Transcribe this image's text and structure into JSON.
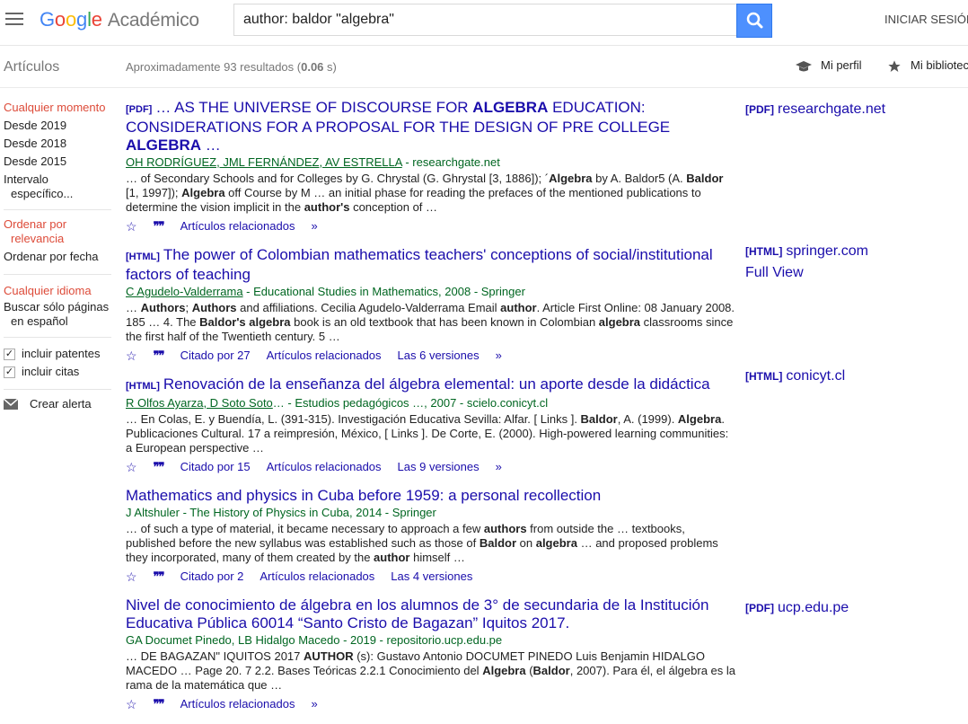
{
  "header": {
    "logo_product": "Académico",
    "search_value": "author: baldor \"algebra\"",
    "signin": "INICIAR SESIÓN"
  },
  "subheader": {
    "section": "Artículos",
    "stats_prefix": "Aproximadamente 93 resultados (",
    "stats_time": "0.06",
    "stats_suffix": " s)",
    "profile": "Mi perfil",
    "library": "Mi biblioteca"
  },
  "sidebar": {
    "time": [
      "Cualquier momento",
      "Desde 2019",
      "Desde 2018",
      "Desde 2015",
      "Intervalo",
      "específico..."
    ],
    "sort": [
      "Ordenar por",
      "relevancia",
      "Ordenar por fecha"
    ],
    "lang": [
      "Cualquier idioma",
      "Buscar sólo páginas",
      "en español"
    ],
    "checks": [
      "incluir patentes",
      "incluir citas"
    ],
    "alert": "Crear alerta"
  },
  "results": [
    {
      "tag": "[PDF]",
      "title_line1": "… AS THE UNIVERSE OF DISCOURSE FOR ",
      "title_b1": "ALGEBRA",
      "title_line1b": " EDUCATION:",
      "title_line2": "CONSIDERATIONS FOR A PROPOSAL FOR THE DESIGN OF PRE COLLEGE",
      "title_b2": "ALGEBRA",
      "title_line3": " …",
      "authors": "OH RODRÍGUEZ, JML FERNÁNDEZ, AV ESTRELLA",
      "venue": " - researchgate.net",
      "snippet": [
        "… of Secondary Schools and for Colleges by G. Chrystal (G. Ghrystal [3, 1886]); ´",
        "Algebra",
        " by A. Baldor5 (A. ",
        "Baldor",
        " [1, 1997]); ",
        "Algebra",
        " off Course by M … an initial phase for reading the prefaces of the mentioned publications to determine the vision implicit in the ",
        "author's",
        " conception of …"
      ],
      "links": [
        "Artículos relacionados"
      ],
      "side_tag": "[PDF]",
      "side_text": "researchgate.net"
    },
    {
      "tag": "[HTML]",
      "title": "The power of Colombian mathematics teachers' conceptions of social/institutional factors of teaching",
      "authors": "C Agudelo-Valderrama",
      "venue": " - Educational Studies in Mathematics, 2008 - Springer",
      "snippet": [
        "… ",
        "Authors",
        "; ",
        "Authors",
        " and affiliations. Cecilia Agudelo-Valderrama Email ",
        "author",
        ". Article First Online: 08 January 2008. 185 … 4. The ",
        "Baldor's algebra",
        " book is an old textbook that has been known in Colombian ",
        "algebra",
        " classrooms since the first half of the Twentieth century. 5 …"
      ],
      "links": [
        "Citado por 27",
        "Artículos relacionados",
        "Las 6 versiones"
      ],
      "side_tag": "[HTML]",
      "side_text": "springer.com",
      "side_extra": "Full View"
    },
    {
      "tag": "[HTML]",
      "title": "Renovación de la enseñanza del álgebra elemental: un aporte desde la didáctica",
      "authors": "R Olfos Ayarza, D Soto Soto",
      "venue": "… - Estudios pedagógicos …, 2007 - scielo.conicyt.cl",
      "snippet": [
        "… En Colas, E. y Buendía, L. (391-315). Investigación Educativa Sevilla: Alfar. [ Links ]. ",
        "Baldor",
        ", A. (1999). ",
        "Algebra",
        ". Publicaciones Cultural. 17 a reimpresión, México, [ Links ]. De Corte, E. (2000). High-powered learning communities: a European perspective …"
      ],
      "links": [
        "Citado por 15",
        "Artículos relacionados",
        "Las 9 versiones"
      ],
      "side_tag": "[HTML]",
      "side_text": "conicyt.cl"
    },
    {
      "title": "Mathematics and physics in Cuba before 1959: a personal recollection",
      "authors": "J Altshuler",
      "venue": " - The History of Physics in Cuba, 2014 - Springer",
      "snippet": [
        "… of such a type of material, it became necessary to approach a few ",
        "authors",
        " from outside the … textbooks, published before the new syllabus was established such as those of ",
        "Baldor",
        " on ",
        "algebra",
        " … and proposed problems they incorporated, many of them created by the ",
        "author",
        " himself …"
      ],
      "links": [
        "Citado por 2",
        "Artículos relacionados",
        "Las 4 versiones"
      ]
    },
    {
      "title": "Nivel de conocimiento de álgebra en los alumnos de 3° de secundaria de la Institución Educativa Pública 60014 “Santo Cristo de Bagazan” Iquitos 2017.",
      "authors": "GA Documet Pinedo, LB Hidalgo Macedo",
      "venue": " - 2019 - repositorio.ucp.edu.pe",
      "snippet": [
        "… DE BAGAZAN\" IQUITOS 2017 ",
        "AUTHOR",
        " (s): Gustavo Antonio DOCUMET PINEDO Luis Benjamin HIDALGO MACEDO … Page 20. 7 2.2. Bases Teóricas 2.2.1 Conocimiento del ",
        "Algebra",
        " (",
        "Baldor",
        ", 2007). Para él, el álgebra es la rama de la matemática que …"
      ],
      "links": [
        "Artículos relacionados"
      ],
      "side_tag": "[PDF]",
      "side_text": "ucp.edu.pe"
    }
  ]
}
